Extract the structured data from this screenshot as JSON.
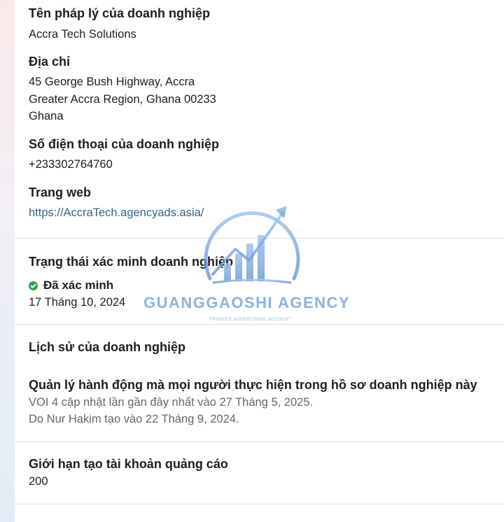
{
  "sections": {
    "legal_name": {
      "label": "Tên pháp lý của doanh nghiệp",
      "value": "Accra Tech Solutions"
    },
    "address": {
      "label": "Địa chỉ",
      "lines": [
        "45 George Bush Highway, Accra",
        "Greater Accra Region, Ghana 00233",
        "Ghana"
      ]
    },
    "phone": {
      "label": "Số điện thoại của doanh nghiệp",
      "value": "+233302764760"
    },
    "website": {
      "label": "Trang web",
      "url": "https://AccraTech.agencyads.asia/"
    },
    "verification": {
      "label": "Trạng thái xác minh doanh nghiệp",
      "status": "Đã xác minh",
      "date": "17 Tháng 10, 2024",
      "status_color": "#31a24c"
    },
    "history": {
      "label": "Lịch sử của doanh nghiệp",
      "subheading": "Quản lý hành động mà mọi người thực hiện trong hồ sơ doanh nghiệp này",
      "lines": [
        "VOI 4 cập nhật lần gần đây nhất vào 27 Tháng 5, 2025.",
        "Do Nur Hakim tạo vào 22 Tháng 9, 2024."
      ]
    },
    "ad_account_limit": {
      "label": "Giới hạn tạo tài khoản quảng cáo",
      "value": "200"
    }
  },
  "watermark": {
    "title": "GUANGGAOSHI AGENCY",
    "subtitle": "TRUSTED ADVERTISING ACCOUNT",
    "color": "#78a5dc"
  },
  "colors": {
    "link": "#2a6a8c",
    "divider": "#dcdee1",
    "muted_text": "#65676b"
  }
}
